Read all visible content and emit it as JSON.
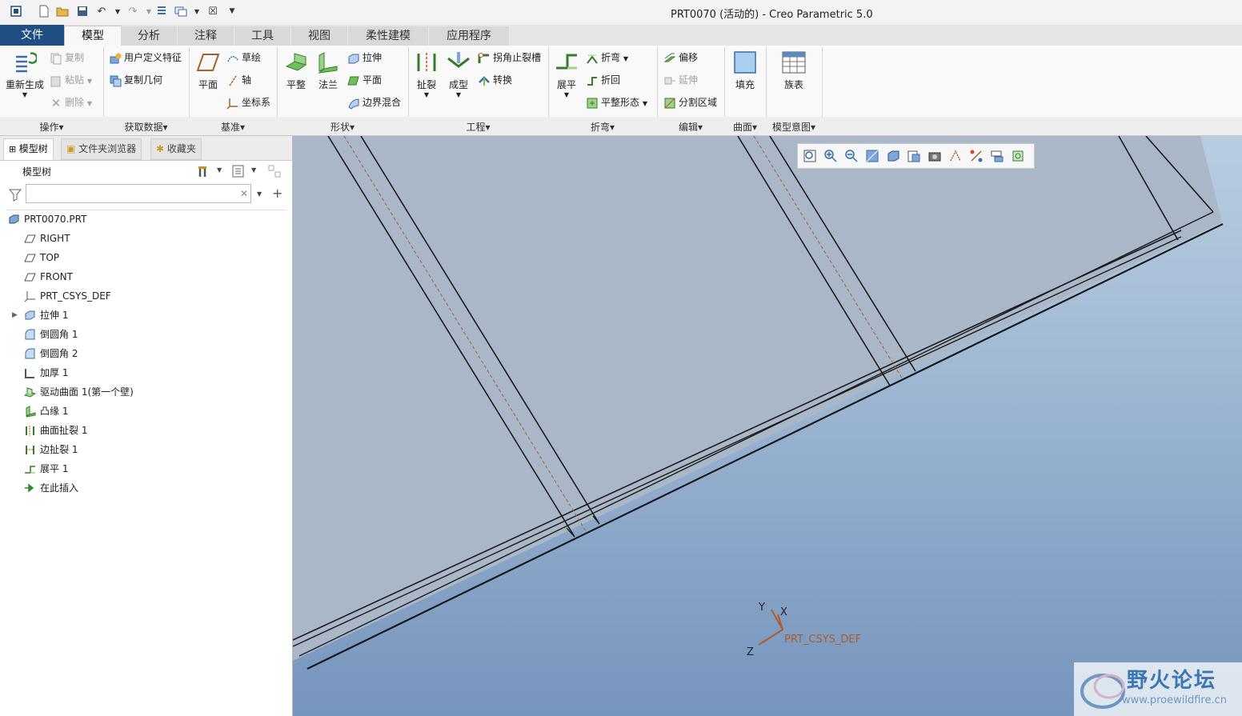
{
  "window": {
    "title": "PRT0070 (活动的) - Creo Parametric 5.0"
  },
  "tabs": [
    {
      "label": "文件"
    },
    {
      "label": "模型"
    },
    {
      "label": "分析"
    },
    {
      "label": "注释"
    },
    {
      "label": "工具"
    },
    {
      "label": "视图"
    },
    {
      "label": "柔性建模"
    },
    {
      "label": "应用程序"
    }
  ],
  "ribbon": {
    "operations": {
      "regenerate": "重新生成",
      "copy": "复制",
      "paste": "粘贴",
      "delete": "删除",
      "group": "操作▾"
    },
    "get_data": {
      "udf": "用户定义特征",
      "copy_geom": "复制几何",
      "group": "获取数据▾"
    },
    "datum": {
      "plane": "平面",
      "sketch": "草绘",
      "axis": "轴",
      "csys": "坐标系",
      "group": "基准▾"
    },
    "shapes": {
      "flat": "平整",
      "flange": "法兰",
      "extrude": "拉伸",
      "planar": "平面",
      "blend": "边界混合",
      "group": "形状▾"
    },
    "engineering": {
      "rip": "扯裂",
      "form": "成型",
      "corner_relief": "拐角止裂槽",
      "convert": "转换",
      "group": "工程▾"
    },
    "bends": {
      "unbend": "展平",
      "bend": "折弯",
      "bend_back": "折回",
      "flat_pattern": "平整形态",
      "group": "折弯▾"
    },
    "editing": {
      "offset": "偏移",
      "extend": "延伸",
      "split": "分割区域",
      "group": "编辑▾"
    },
    "surfaces": {
      "fill": "填充",
      "group": "曲面▾"
    },
    "model_intent": {
      "family": "族表",
      "group": "模型意图▾"
    }
  },
  "left_panel": {
    "tabs": [
      {
        "label": "模型树"
      },
      {
        "label": "文件夹浏览器"
      },
      {
        "label": "收藏夹"
      }
    ],
    "header": "模型树",
    "filter_placeholder": "",
    "tree": [
      {
        "label": "PRT0070.PRT",
        "icon": "part-icon"
      },
      {
        "label": "RIGHT",
        "icon": "datum-plane-icon"
      },
      {
        "label": "TOP",
        "icon": "datum-plane-icon"
      },
      {
        "label": "FRONT",
        "icon": "datum-plane-icon"
      },
      {
        "label": "PRT_CSYS_DEF",
        "icon": "csys-icon"
      },
      {
        "label": "拉伸 1",
        "icon": "extrude-icon"
      },
      {
        "label": "倒圆角 1",
        "icon": "round-icon"
      },
      {
        "label": "倒圆角 2",
        "icon": "round-icon"
      },
      {
        "label": "加厚 1",
        "icon": "thicken-icon"
      },
      {
        "label": "驱动曲面 1(第一个壁)",
        "icon": "driving-surface-icon"
      },
      {
        "label": "凸缘 1",
        "icon": "flange-icon"
      },
      {
        "label": "曲面扯裂 1",
        "icon": "surface-rip-icon"
      },
      {
        "label": "边扯裂 1",
        "icon": "edge-rip-icon"
      },
      {
        "label": "展平 1",
        "icon": "unbend-icon"
      },
      {
        "label": "在此插入",
        "icon": "insert-here-icon"
      }
    ]
  },
  "viewport": {
    "csys_label": "PRT_CSYS_DEF",
    "axis_x": "X",
    "axis_y": "Y",
    "axis_z": "Z",
    "watermark_title": "野火论坛",
    "watermark_url": "www.proewildfire.cn"
  },
  "colors": {
    "file_tab": "#1f4e83",
    "viewport_top": "#b8cde0",
    "viewport_bottom": "#7695bd",
    "part_face": "#a9b7c9",
    "bend_line": "#b05b2a"
  }
}
